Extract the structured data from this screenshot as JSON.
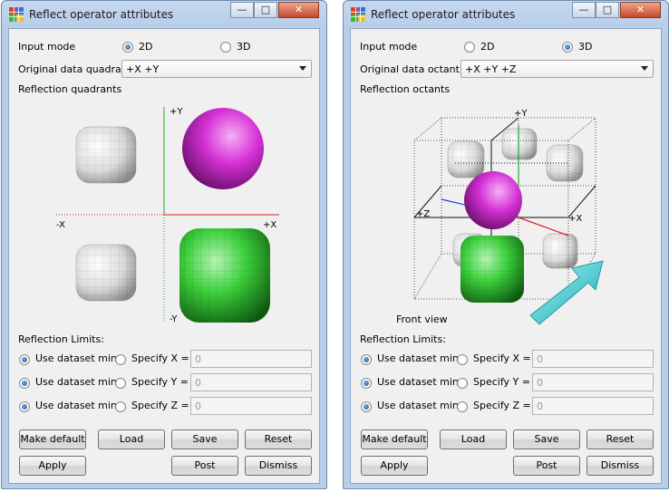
{
  "windows": [
    {
      "title": "Reflect operator attributes",
      "input_mode_label": "Input mode",
      "mode_2d": "2D",
      "mode_3d": "3D",
      "selected_mode": "2D",
      "original_label": "Original data quadrant",
      "original_value": "+X  +Y",
      "reflection_label": "Reflection quadrants",
      "axes": {
        "plus_y": "+Y",
        "minus_x": "-X",
        "plus_x": "+X",
        "minus_y": "-Y"
      },
      "limits_label": "Reflection Limits:",
      "limits": [
        {
          "use_label": "Use dataset min",
          "specify_label": "Specify X =",
          "value": "0"
        },
        {
          "use_label": "Use dataset min",
          "specify_label": "Specify Y =",
          "value": "0"
        },
        {
          "use_label": "Use dataset min",
          "specify_label": "Specify Z =",
          "value": "0"
        }
      ],
      "buttons": {
        "make_default": "Make default",
        "load": "Load",
        "save": "Save",
        "reset": "Reset",
        "apply": "Apply",
        "post": "Post",
        "dismiss": "Dismiss"
      }
    },
    {
      "title": "Reflect operator attributes",
      "input_mode_label": "Input mode",
      "mode_2d": "2D",
      "mode_3d": "3D",
      "selected_mode": "3D",
      "original_label": "Original data octant",
      "original_value": "+X  +Y  +Z",
      "reflection_label": "Reflection octants",
      "axes": {
        "plus_y": "+Y",
        "plus_z": "+Z",
        "plus_x": "+X"
      },
      "front_view": "Front view",
      "limits_label": "Reflection Limits:",
      "limits": [
        {
          "use_label": "Use dataset min",
          "specify_label": "Specify X =",
          "value": "0"
        },
        {
          "use_label": "Use dataset min",
          "specify_label": "Specify Y =",
          "value": "0"
        },
        {
          "use_label": "Use dataset min",
          "specify_label": "Specify Z =",
          "value": "0"
        }
      ],
      "buttons": {
        "make_default": "Make default",
        "load": "Load",
        "save": "Save",
        "reset": "Reset",
        "apply": "Apply",
        "post": "Post",
        "dismiss": "Dismiss"
      }
    }
  ],
  "titlebar_buttons": {
    "minimize": "—",
    "maximize": "□",
    "close": "✕"
  },
  "icons": {
    "app": "rainbow-grid-icon",
    "minimize": "minimize-icon",
    "maximize": "maximize-icon",
    "close": "close-icon"
  },
  "colors": {
    "original_green": "#2fc22f",
    "reflected_magenta": "#d020d0",
    "reflected_white": "#e8e8e8",
    "arrow_cyan": "#40d0d8",
    "axis_red": "#e02020",
    "axis_green": "#20b020",
    "axis_blue": "#2040e0"
  }
}
